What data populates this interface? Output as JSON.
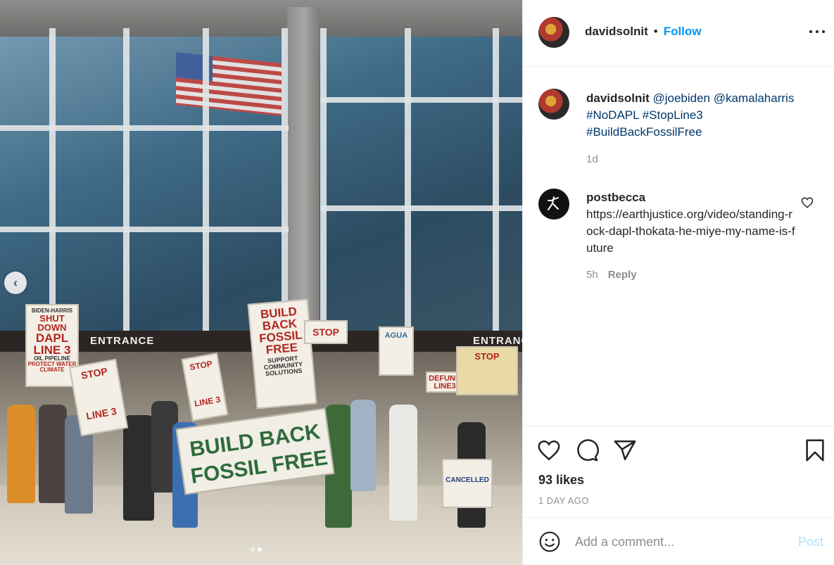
{
  "post": {
    "username": "davidsolnit",
    "follow_label": "Follow",
    "bullet": "•",
    "caption": {
      "username": "davidsolnit",
      "mention_1": "@joebiden",
      "mention_2": "@kamalaharris",
      "hashtag_1": "#NoDAPL",
      "hashtag_2": "#StopLine3",
      "hashtag_3": "#BuildBackFossilFree",
      "age": "1d"
    },
    "comments": [
      {
        "username": "postbecca",
        "text": "https://earthjustice.org/video/standing-rock-dapl-thokata-he-miye-my-name-is-future",
        "age": "5h",
        "reply_label": "Reply"
      }
    ],
    "likes": "93 likes",
    "date": "1 DAY AGO",
    "comment_input": {
      "placeholder": "Add a comment..."
    },
    "post_label": "Post",
    "carousel": {
      "count": 2,
      "active": 2
    }
  },
  "photo": {
    "entrance_1": "ENTRANCE",
    "entrance_2": "ENTRANCE",
    "sign_biden": [
      "BIDEN-HARRIS",
      "SHUT DOWN",
      "DAPL",
      "LINE 3",
      "OIL PIPELINE",
      "PROTECT WATER",
      "CLIMATE"
    ],
    "sign_build": [
      "BUILD",
      "BACK",
      "FOSSIL",
      "FREE",
      "SUPPORT",
      "COMMUNITY",
      "SOLUTIONS"
    ],
    "sign_stop_line3": [
      "STOP",
      "LINE 3"
    ],
    "sign_stop": [
      "STOP"
    ],
    "sign_agua": [
      "AGUA"
    ],
    "sign_defund": [
      "DEFUND",
      "LINE3"
    ],
    "sign_cancelled": [
      "CANCELLED"
    ],
    "banner": [
      "BUILD BACK",
      "FOSSIL FREE"
    ]
  },
  "colors": {
    "accent": "#0095f6",
    "link": "#00376b",
    "muted": "#8e8e8e",
    "post_disabled": "#b2dffc"
  },
  "icons": [
    "more-icon",
    "heart-icon",
    "comment-icon",
    "share-icon",
    "bookmark-icon",
    "emoji-icon",
    "chevron-left-icon"
  ]
}
